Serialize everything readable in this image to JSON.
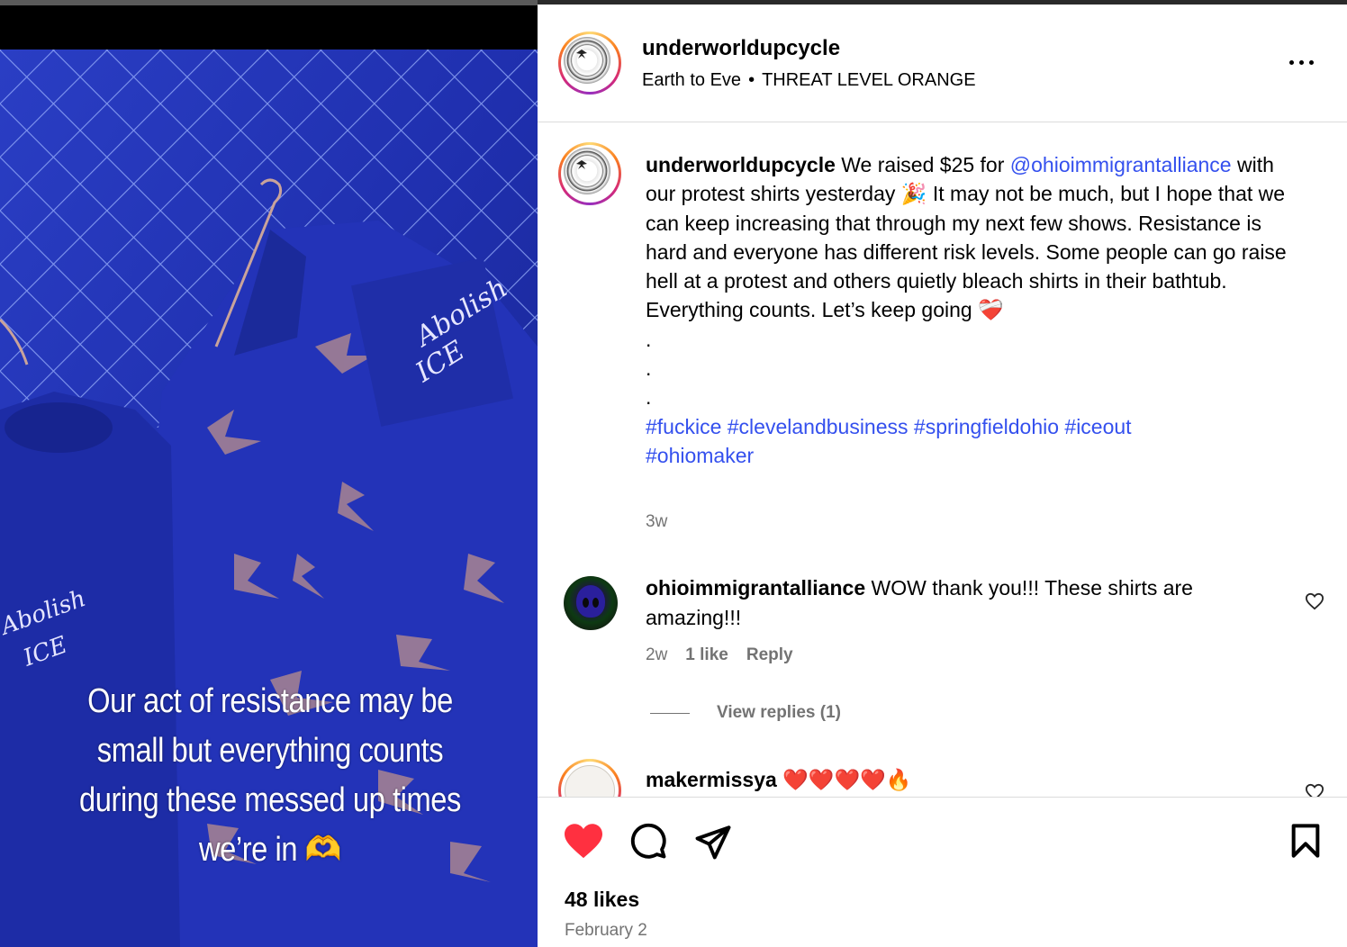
{
  "post": {
    "username": "underworldupcycle",
    "audio_artist": "Earth to Eve",
    "audio_track": "THREAT LEVEL ORANGE",
    "media_overlay_text": [
      "Our act of resistance may be",
      "small but everything counts",
      "during these messed up times",
      "we’re in"
    ],
    "media_overlay_emoji": "🫶",
    "caption": {
      "username": "underworldupcycle",
      "part1": " We raised $25 for ",
      "mention": "@ohioimmigrantalliance",
      "part2": " with our protest shirts yesterday ",
      "emoji1": "🎉",
      "part3": " It may not be much, but I hope that we can keep increasing that through my next few shows. Resistance is hard and everyone has different risk levels. Some people can go raise hell at a protest and others quietly bleach shirts in their bathtub. Everything counts. Let’s keep going ",
      "emoji2": "❤️‍🩹",
      "dots": [
        ".",
        ".",
        "."
      ],
      "hashtags": "#fuckice #clevelandbusiness #springfieldohio #iceout #ohiomaker"
    },
    "caption_time": "3w",
    "likes": "48 likes",
    "date": "February 2"
  },
  "comments": [
    {
      "username": "ohioimmigrantalliance",
      "text": " WOW thank you!!! These shirts are amazing!!!",
      "time": "2w",
      "likes": "1 like",
      "reply_label": "Reply",
      "view_replies": "View replies (1)"
    },
    {
      "username": "makermissya",
      "text": " ❤️❤️❤️❤️🔥"
    }
  ],
  "icons": {
    "more": "more-options-icon",
    "like": "heart-filled-icon",
    "comment": "comment-bubble-icon",
    "share": "paper-plane-icon",
    "save": "bookmark-icon",
    "comment_like": "heart-outline-icon"
  },
  "colors": {
    "link": "#3450ee",
    "like_active": "#ff3040",
    "secondary_text": "#737373"
  }
}
